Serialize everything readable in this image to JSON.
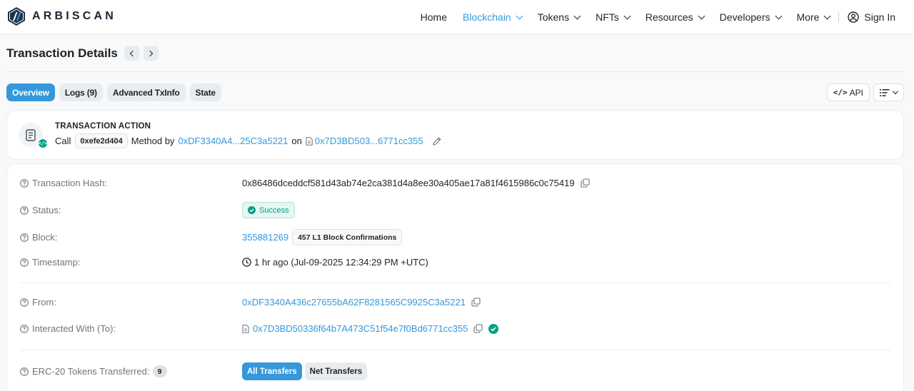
{
  "brand": {
    "name": "ARBISCAN"
  },
  "nav": {
    "items": [
      {
        "label": "Home"
      },
      {
        "label": "Blockchain"
      },
      {
        "label": "Tokens"
      },
      {
        "label": "NFTs"
      },
      {
        "label": "Resources"
      },
      {
        "label": "Developers"
      },
      {
        "label": "More"
      }
    ],
    "sign_in": "Sign In"
  },
  "page": {
    "title": "Transaction Details"
  },
  "tabs": [
    {
      "label": "Overview"
    },
    {
      "label": "Logs (9)"
    },
    {
      "label": "Advanced TxInfo"
    },
    {
      "label": "State"
    }
  ],
  "tools": {
    "api_label": "API"
  },
  "action": {
    "heading": "TRANSACTION ACTION",
    "call": "Call",
    "method_id": "0xefe2d404",
    "method_by": "Method by",
    "from_short": "0xDF3340A4...25C3a5221",
    "on": "on",
    "to_short": "0x7D3BD503...6771cc355"
  },
  "details": {
    "hash": {
      "label": "Transaction Hash:",
      "value": "0x86486dceddcf581d43ab74e2ca381d4a8ee30a405ae17a81f4615986c0c75419"
    },
    "status": {
      "label": "Status:",
      "value": "Success"
    },
    "block": {
      "label": "Block:",
      "value": "355881269",
      "confirmations": "457 L1 Block Confirmations"
    },
    "timestamp": {
      "label": "Timestamp:",
      "value": "1 hr ago (Jul-09-2025 12:34:29 PM +UTC)"
    },
    "from": {
      "label": "From:",
      "value": "0xDF3340A436c27655bA62F8281565C9925C3a5221"
    },
    "to": {
      "label": "Interacted With (To):",
      "value": "0x7D3BD50336f64b7A473C51f54e7f0Bd6771cc355"
    },
    "erc20": {
      "label": "ERC-20 Tokens Transferred:",
      "count": "9",
      "all_label": "All Transfers",
      "net_label": "Net Transfers"
    }
  },
  "colors": {
    "accent": "#3498db",
    "success": "#00a186"
  }
}
